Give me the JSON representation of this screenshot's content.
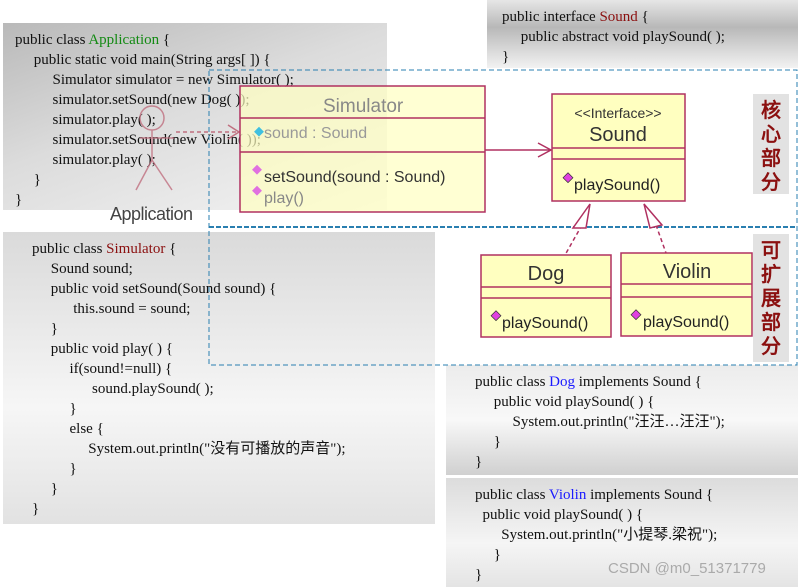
{
  "code_panels": {
    "application": {
      "pre": "public class ",
      "name": "Application",
      "post": " {",
      "color": "green",
      "lines": [
        "     public static void main(String args[ ]) {",
        "          Simulator simulator = new Simulator( );",
        "          simulator.setSound(new Dog( ));",
        "          simulator.play( );",
        "          simulator.setSound(new Violin( ));",
        "          simulator.play( );",
        "     }",
        "}"
      ]
    },
    "sound": {
      "pre": "public interface ",
      "name": "Sound",
      "post": " {",
      "color": "red",
      "lines": [
        "     public abstract void playSound( );",
        "}"
      ]
    },
    "simulator": {
      "pre": "public class ",
      "name": "Simulator",
      "post": " {",
      "color": "red",
      "lines": [
        "     Sound sound;",
        "     public void setSound(Sound sound) {",
        "           this.sound = sound;",
        "     }",
        "     public void play( ) {",
        "          if(sound!=null) {",
        "                sound.playSound( );",
        "          }",
        "          else {",
        "               System.out.println(\"没有可播放的声音\");",
        "          }",
        "     }",
        "}"
      ]
    },
    "dog": {
      "pre": "public class ",
      "name": "Dog",
      "post": " implements Sound {",
      "color": "blue",
      "lines": [
        "     public void playSound( ) {",
        "          System.out.println(\"汪汪…汪汪\");",
        "     }",
        "}"
      ]
    },
    "violin": {
      "pre": "public class ",
      "name": "Violin",
      "post": " implements Sound {",
      "color": "blue",
      "lines": [
        "  public void playSound( ) {",
        "       System.out.println(\"小提琴.梁祝\");",
        "     }",
        "}"
      ]
    }
  },
  "uml": {
    "simulator": {
      "name": "Simulator",
      "attribute": "sound : Sound",
      "methods": [
        "setSound(sound : Sound)",
        "play()"
      ]
    },
    "sound": {
      "stereotype": "<<Interface>>",
      "name": "Sound",
      "methods": [
        "playSound()"
      ]
    },
    "dog": {
      "name": "Dog",
      "methods": [
        "playSound()"
      ]
    },
    "violin": {
      "name": "Violin",
      "methods": [
        "playSound()"
      ]
    },
    "actor": {
      "name": "Application"
    }
  },
  "regions": {
    "core": "核心部分",
    "extensible": "可扩展部分"
  },
  "watermark": "CSDN @m0_51371779",
  "colors": {
    "uml_fill": "#ffffc0",
    "uml_border": "#b03060",
    "region_border": "#2a7fb0",
    "method_icon": "#e040e0"
  }
}
